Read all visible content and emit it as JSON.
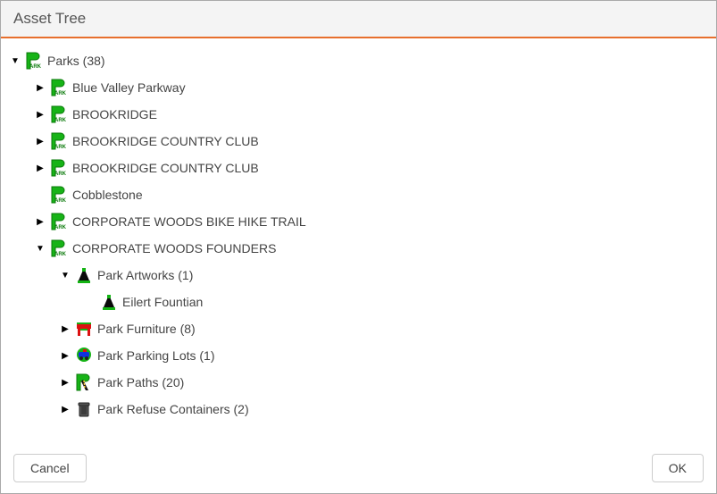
{
  "dialog": {
    "title": "Asset Tree",
    "cancel_label": "Cancel",
    "ok_label": "OK"
  },
  "tree": {
    "root": {
      "label": "Parks (38)",
      "icon": "park",
      "expanded": true,
      "children": [
        {
          "label": "Blue Valley Parkway",
          "icon": "park",
          "expandable": true
        },
        {
          "label": "BROOKRIDGE",
          "icon": "park",
          "expandable": true
        },
        {
          "label": "BROOKRIDGE COUNTRY CLUB",
          "icon": "park",
          "expandable": true
        },
        {
          "label": "BROOKRIDGE COUNTRY CLUB",
          "icon": "park",
          "expandable": true
        },
        {
          "label": "Cobblestone",
          "icon": "park",
          "expandable": false
        },
        {
          "label": "CORPORATE WOODS BIKE HIKE TRAIL",
          "icon": "park",
          "expandable": true
        },
        {
          "label": "CORPORATE WOODS FOUNDERS",
          "icon": "park",
          "expandable": true,
          "expanded": true,
          "children": [
            {
              "label": "Park Artworks (1)",
              "icon": "artwork",
              "expandable": true,
              "expanded": true,
              "children": [
                {
                  "label": "Eilert Fountian",
                  "icon": "artwork",
                  "expandable": false
                }
              ]
            },
            {
              "label": "Park Furniture (8)",
              "icon": "furniture",
              "expandable": true
            },
            {
              "label": "Park Parking Lots (1)",
              "icon": "parking",
              "expandable": true
            },
            {
              "label": "Park Paths (20)",
              "icon": "path",
              "expandable": true
            },
            {
              "label": "Park Refuse Containers (2)",
              "icon": "refuse",
              "expandable": true
            }
          ]
        }
      ]
    }
  }
}
